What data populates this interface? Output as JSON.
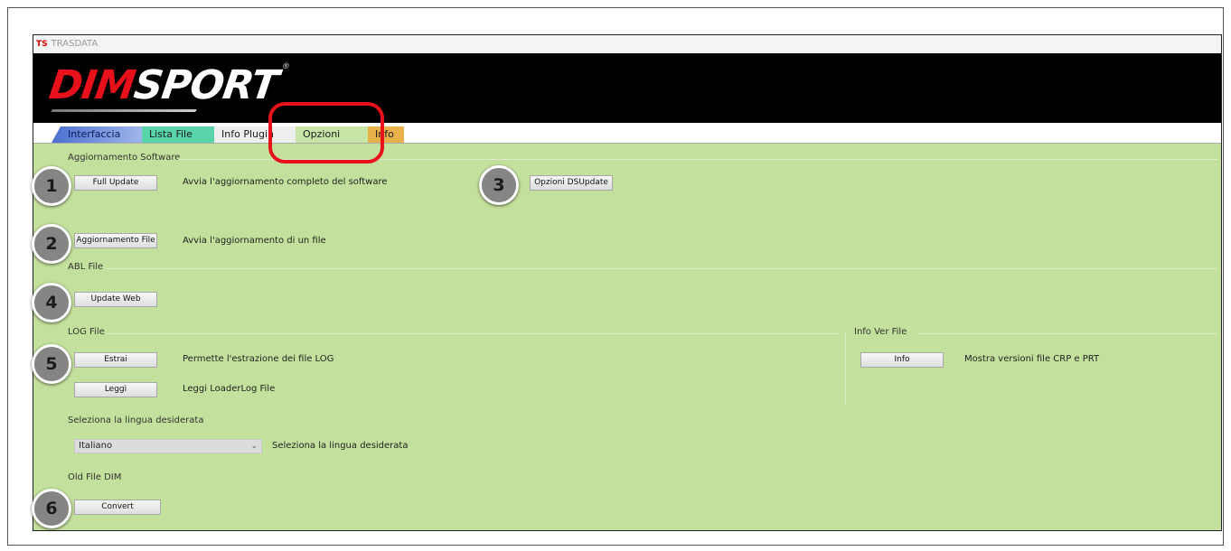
{
  "window": {
    "app_icon": "TS",
    "title": "TRASDATA"
  },
  "logo": {
    "part1": "DIM",
    "part2": "SPORT",
    "reg": "®"
  },
  "tabs": [
    {
      "label": "Interfaccia"
    },
    {
      "label": "Lista File"
    },
    {
      "label": "Info Plugin"
    },
    {
      "label": "Opzioni"
    },
    {
      "label": "Info"
    }
  ],
  "software_update": {
    "title": "Aggiornamento Software",
    "full_update_button": "Full Update",
    "full_update_desc": "Avvia l'aggiornamento completo del software",
    "dsupdate_button": "Opzioni DSUpdate",
    "file_update_button": "Aggiornamento File",
    "file_update_desc": "Avvia l'aggiornamento di un file"
  },
  "abl_file": {
    "title": "ABL File",
    "update_web_button": "Update Web"
  },
  "log_file": {
    "title": "LOG File",
    "extract_button": "Estrai",
    "extract_desc": "Permette l'estrazione dei file LOG",
    "read_button": "Leggi",
    "read_desc": "Leggi LoaderLog File"
  },
  "info_ver_file": {
    "title": "Info Ver File",
    "info_button": "Info",
    "info_desc": "Mostra versioni file CRP e PRT"
  },
  "language": {
    "title": "Seleziona la lingua desiderata",
    "selected": "Italiano",
    "desc": "Seleziona la lingua desiderata"
  },
  "old_file": {
    "title": "Old File DIM",
    "convert_button": "Convert"
  },
  "callouts": [
    "1",
    "2",
    "3",
    "4",
    "5",
    "6"
  ],
  "colors": {
    "panel_bg": "#c3e09c",
    "highlight": "#e8121a",
    "badge": "#858585"
  }
}
